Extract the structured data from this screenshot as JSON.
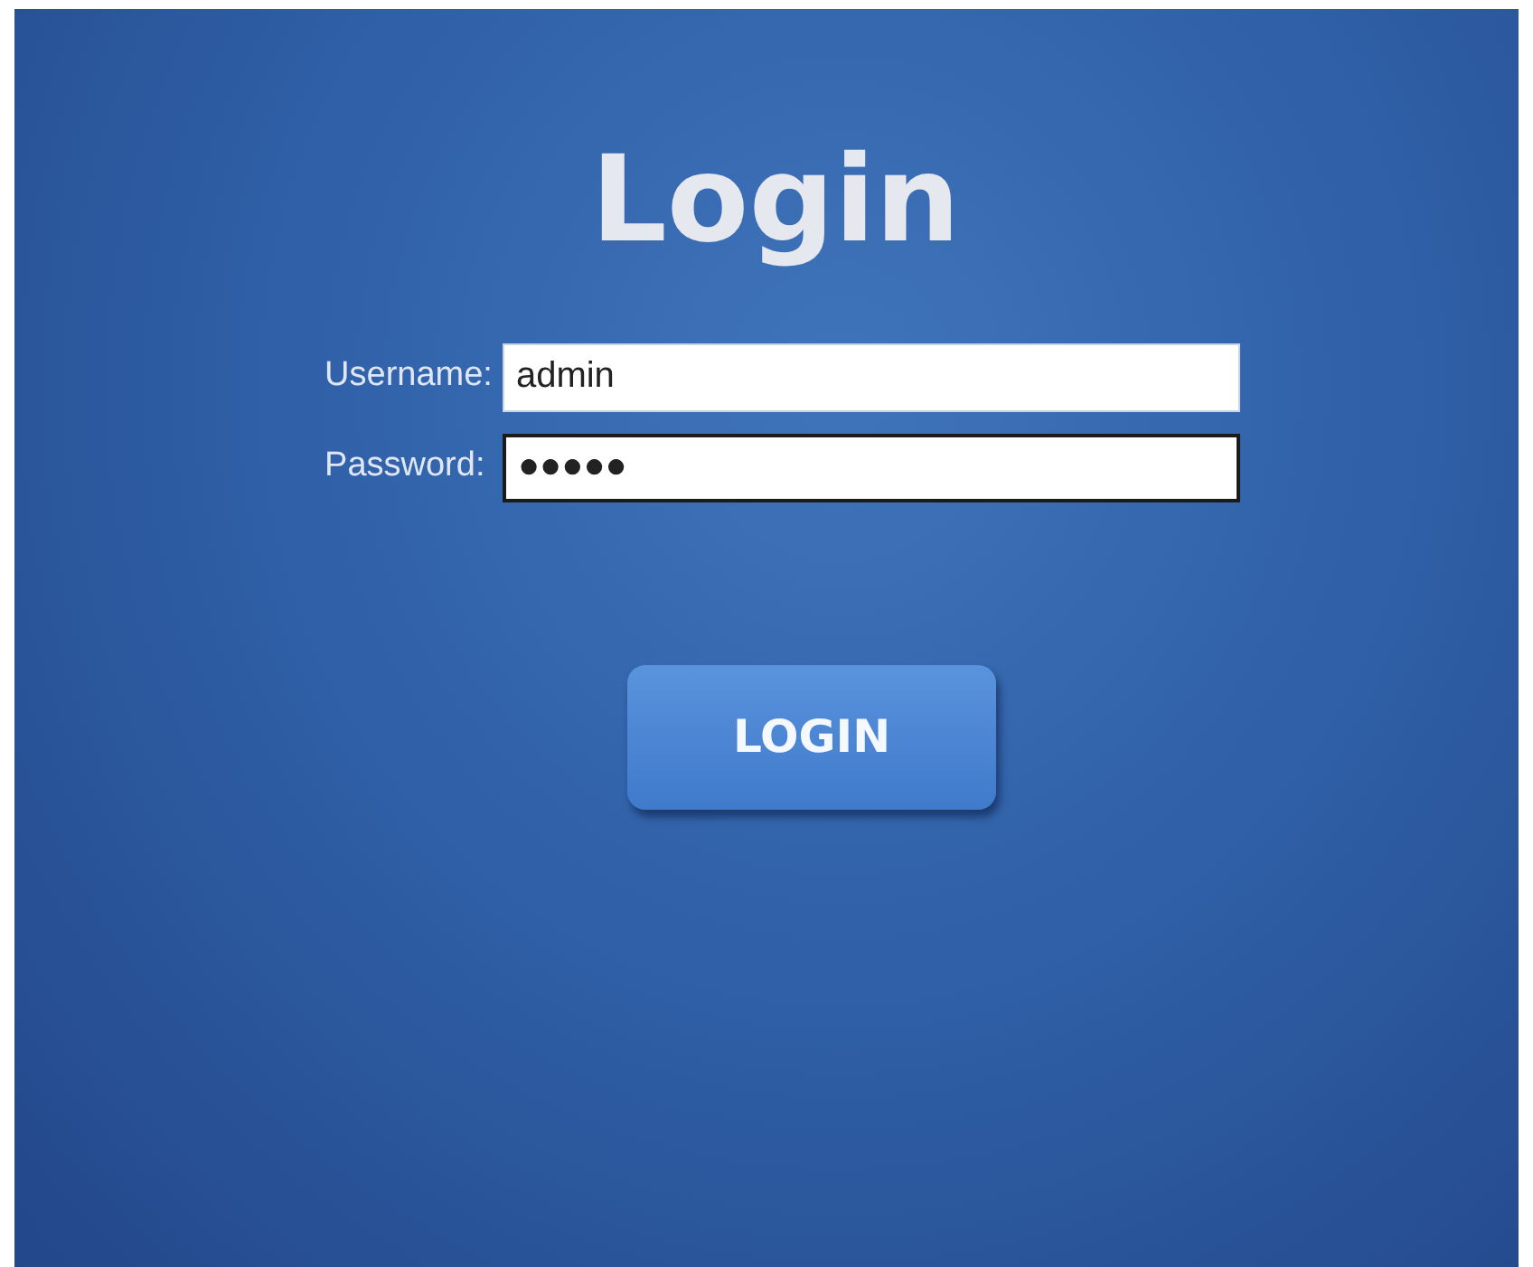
{
  "title": "Login",
  "fields": [
    {
      "label": "Username:",
      "value": "admin",
      "focused": false
    },
    {
      "label": "Password:",
      "value": "●●●●●",
      "focused": true
    }
  ],
  "button": "LOGIN"
}
